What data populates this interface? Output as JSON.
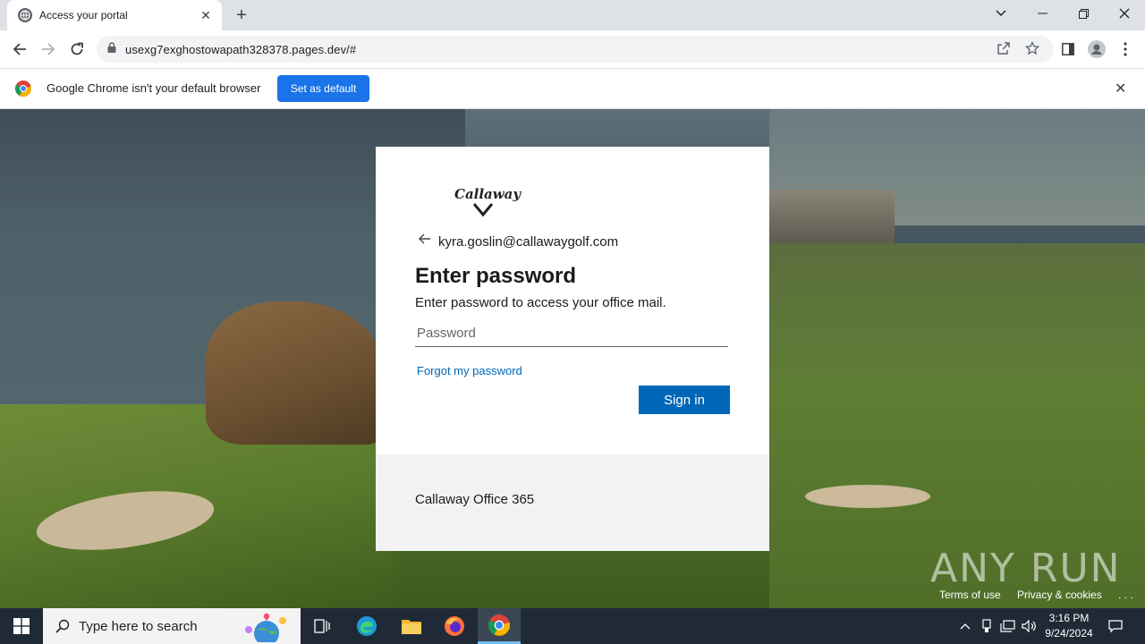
{
  "browser": {
    "tab_title": "Access your portal",
    "url": "usexg7exghostowapath328378.pages.dev/#",
    "infobar_message": "Google Chrome isn't your default browser",
    "infobar_button": "Set as default"
  },
  "login": {
    "logo_text": "Callaway",
    "email": "kyra.goslin@callawaygolf.com",
    "heading": "Enter password",
    "subtitle": "Enter password to access your office mail.",
    "password_placeholder": "Password",
    "forgot_link": "Forgot my password",
    "signin_button": "Sign in",
    "footer_text": "Callaway Office 365"
  },
  "page_footer": {
    "terms": "Terms of use",
    "privacy": "Privacy & cookies",
    "more": ". . ."
  },
  "watermark": "ANY RUN",
  "taskbar": {
    "search_placeholder": "Type here to search",
    "time": "3:16 PM",
    "date": "9/24/2024"
  },
  "colors": {
    "primary_button": "#0067b8",
    "chrome_blue": "#1a73e8",
    "taskbar": "#1f2a36"
  }
}
